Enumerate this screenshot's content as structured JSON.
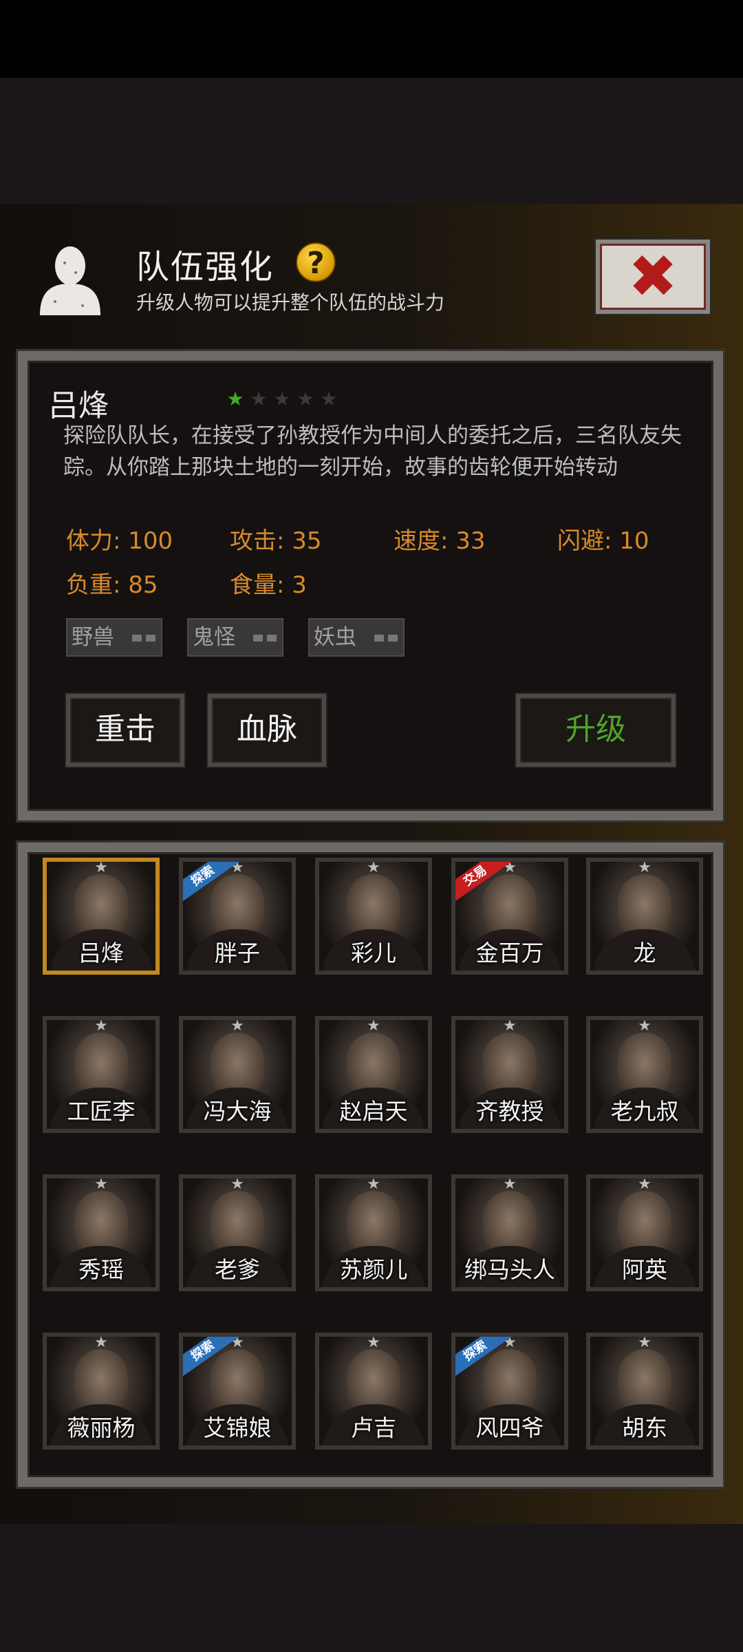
{
  "header": {
    "title": "队伍强化",
    "help_glyph": "?",
    "subtitle": "升级人物可以提升整个队伍的战斗力",
    "close_glyph": "✖"
  },
  "character": {
    "name": "吕烽",
    "stars": {
      "filled": 1,
      "total": 5
    },
    "description": "探险队队长，在接受了孙教授作为中间人的委托之后，三名队友失踪。从你踏上那块土地的一刻开始，故事的齿轮便开始转动",
    "stats": {
      "hp": "体力: 100",
      "attack": "攻击: 35",
      "speed": "速度: 33",
      "dodge": "闪避: 10",
      "load": "负重: 85",
      "food": "食量: 3"
    },
    "tags": [
      "野兽",
      "鬼怪",
      "妖虫"
    ]
  },
  "actions": {
    "skill1": "重击",
    "skill2": "血脉",
    "upgrade": "升级"
  },
  "colors": {
    "stat_text": "#d98a2b",
    "upgrade_text": "#4fa52a",
    "star_on": "#3fb11f",
    "selected_border": "#c08a1f",
    "ribbon_explore": "#2a6fb8",
    "ribbon_trade": "#c81e1e"
  },
  "roster": [
    {
      "name": "吕烽",
      "selected": true,
      "ribbon": ""
    },
    {
      "name": "胖子",
      "selected": false,
      "ribbon": "探索"
    },
    {
      "name": "彩儿",
      "selected": false,
      "ribbon": ""
    },
    {
      "name": "金百万",
      "selected": false,
      "ribbon": "交易"
    },
    {
      "name": "龙",
      "selected": false,
      "ribbon": ""
    },
    {
      "name": "工匠李",
      "selected": false,
      "ribbon": ""
    },
    {
      "name": "冯大海",
      "selected": false,
      "ribbon": ""
    },
    {
      "name": "赵启天",
      "selected": false,
      "ribbon": ""
    },
    {
      "name": "齐教授",
      "selected": false,
      "ribbon": ""
    },
    {
      "name": "老九叔",
      "selected": false,
      "ribbon": ""
    },
    {
      "name": "秀瑶",
      "selected": false,
      "ribbon": ""
    },
    {
      "name": "老爹",
      "selected": false,
      "ribbon": ""
    },
    {
      "name": "苏颜儿",
      "selected": false,
      "ribbon": ""
    },
    {
      "name": "绑马头人",
      "selected": false,
      "ribbon": ""
    },
    {
      "name": "阿英",
      "selected": false,
      "ribbon": ""
    },
    {
      "name": "薇丽杨",
      "selected": false,
      "ribbon": ""
    },
    {
      "name": "艾锦娘",
      "selected": false,
      "ribbon": "探索"
    },
    {
      "name": "卢吉",
      "selected": false,
      "ribbon": ""
    },
    {
      "name": "风四爷",
      "selected": false,
      "ribbon": "探索"
    },
    {
      "name": "胡东",
      "selected": false,
      "ribbon": ""
    }
  ]
}
